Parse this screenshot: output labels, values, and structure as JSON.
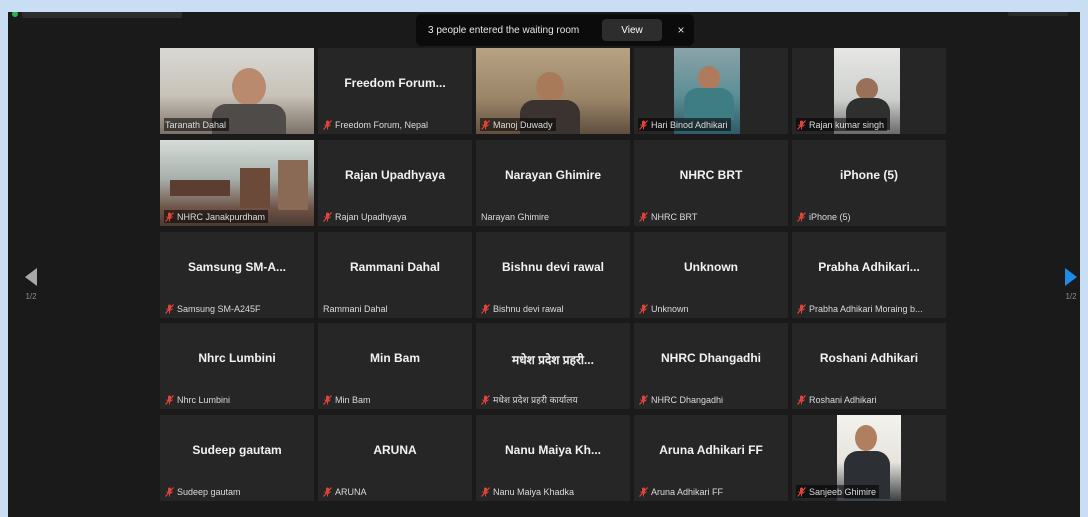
{
  "notification": {
    "text": "3 people entered the waiting room",
    "view_label": "View",
    "close_glyph": "×"
  },
  "pagination": {
    "left_page": "1/2",
    "right_page": "1/2"
  },
  "colors": {
    "active_speaker_border": "#c3e23c",
    "mute_icon": "#e0443a",
    "next_arrow": "#1c8ce6"
  },
  "participants": [
    {
      "display_name": "",
      "footer_name": "Taranath Dahal",
      "muted": false,
      "video": true,
      "active": true
    },
    {
      "display_name": "Freedom  Forum...",
      "footer_name": "Freedom Forum, Nepal",
      "muted": true,
      "video": false
    },
    {
      "display_name": "",
      "footer_name": "Manoj Duwady",
      "muted": true,
      "video": true
    },
    {
      "display_name": "",
      "footer_name": "Hari Binod Adhikari",
      "muted": true,
      "video": true
    },
    {
      "display_name": "",
      "footer_name": "Rajan kumar singh",
      "muted": true,
      "video": true
    },
    {
      "display_name": "",
      "footer_name": "NHRC Janakpurdham",
      "muted": true,
      "video": true
    },
    {
      "display_name": "Rajan Upadhyaya",
      "footer_name": "Rajan Upadhyaya",
      "muted": true,
      "video": false
    },
    {
      "display_name": "Narayan Ghimire",
      "footer_name": "Narayan Ghimire",
      "muted": false,
      "video": false
    },
    {
      "display_name": "NHRC BRT",
      "footer_name": "NHRC BRT",
      "muted": true,
      "video": false
    },
    {
      "display_name": "iPhone (5)",
      "footer_name": "iPhone (5)",
      "muted": true,
      "video": false
    },
    {
      "display_name": "Samsung  SM-A...",
      "footer_name": "Samsung SM-A245F",
      "muted": true,
      "video": false
    },
    {
      "display_name": "Rammani Dahal",
      "footer_name": "Rammani Dahal",
      "muted": false,
      "video": false
    },
    {
      "display_name": "Bishnu devi rawal",
      "footer_name": "Bishnu devi rawal",
      "muted": true,
      "video": false
    },
    {
      "display_name": "Unknown",
      "footer_name": "Unknown",
      "muted": true,
      "video": false
    },
    {
      "display_name": "Prabha  Adhikari...",
      "footer_name": "Prabha Adhikari Moraing b...",
      "muted": true,
      "video": false
    },
    {
      "display_name": "Nhrc Lumbini",
      "footer_name": "Nhrc Lumbini",
      "muted": true,
      "video": false
    },
    {
      "display_name": "Min Bam",
      "footer_name": "Min Bam",
      "muted": true,
      "video": false
    },
    {
      "display_name": "मधेश प्रदेश प्रहरी...",
      "footer_name": "मधेश प्रदेश प्रहरी कार्यालय",
      "muted": true,
      "video": false
    },
    {
      "display_name": "NHRC Dhangadhi",
      "footer_name": "NHRC Dhangadhi",
      "muted": true,
      "video": false
    },
    {
      "display_name": "Roshani Adhikari",
      "footer_name": "Roshani Adhikari",
      "muted": true,
      "video": false
    },
    {
      "display_name": "Sudeep gautam",
      "footer_name": "Sudeep gautam",
      "muted": true,
      "video": false
    },
    {
      "display_name": "ARUNA",
      "footer_name": "ARUNA",
      "muted": true,
      "video": false
    },
    {
      "display_name": "Nanu  Maiya  Kh...",
      "footer_name": "Nanu Maiya Khadka",
      "muted": true,
      "video": false
    },
    {
      "display_name": "Aruna Adhikari FF",
      "footer_name": "Aruna Adhikari FF",
      "muted": true,
      "video": false
    },
    {
      "display_name": "",
      "footer_name": "Sanjeeb Ghimire",
      "muted": true,
      "video": true
    }
  ]
}
